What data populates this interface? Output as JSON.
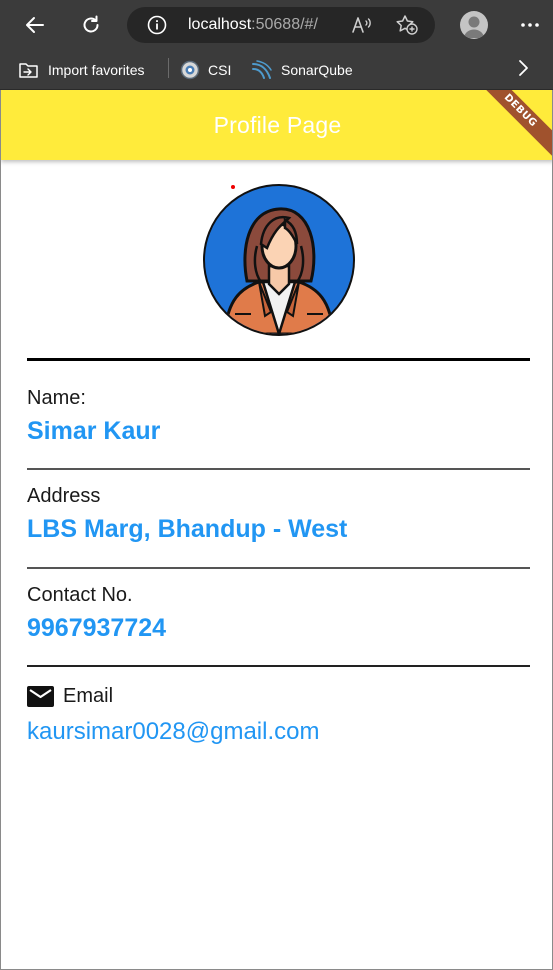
{
  "browser": {
    "url_host": "localhost",
    "url_rest": ":50688/#/",
    "favorites": [
      {
        "label": "Import favorites",
        "icon": "import-folder-icon"
      },
      {
        "label": "CSI",
        "icon": "csi-icon"
      },
      {
        "label": "SonarQube",
        "icon": "sonarqube-icon"
      }
    ]
  },
  "app": {
    "title": "Profile Page",
    "debug_banner": "DEBUG",
    "accent_color": "#ffeb3b",
    "value_color": "#2196f3"
  },
  "profile": {
    "name_label": "Name:",
    "name_value": "Simar Kaur",
    "address_label": "Address",
    "address_value": "LBS Marg, Bhandup - West",
    "contact_label": "Contact No.",
    "contact_value": "9967937724",
    "email_label": "Email",
    "email_value": "kaursimar0028@gmail.com"
  }
}
